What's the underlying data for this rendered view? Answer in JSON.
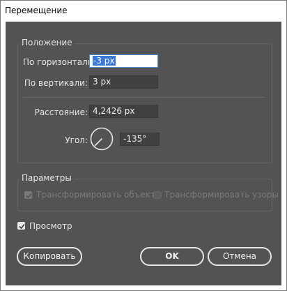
{
  "window": {
    "title": "Перемещение"
  },
  "position": {
    "group_label": "Положение",
    "horizontal_label": "По горизонтали:",
    "horizontal_value": "-3 px",
    "vertical_label": "По вертикали:",
    "vertical_value": "3 px",
    "distance_label": "Расстояние:",
    "distance_value": "4,2426 px",
    "angle_label": "Угол:",
    "angle_value": "-135°"
  },
  "options": {
    "group_label": "Параметры",
    "transform_objects_label": "Трансформировать объекты",
    "transform_objects_checked": true,
    "transform_patterns_label": "Трансформировать узоры",
    "transform_patterns_checked": false
  },
  "preview": {
    "label": "Просмотр",
    "checked": true
  },
  "buttons": {
    "copy": "Копировать",
    "ok": "OK",
    "cancel": "Отмена"
  },
  "icons": {
    "angle_dial": "angle-dial-icon",
    "check": "check-icon"
  },
  "colors": {
    "dialog_bg": "#535353",
    "field_bg": "#414141",
    "selection": "#3b78d8"
  }
}
